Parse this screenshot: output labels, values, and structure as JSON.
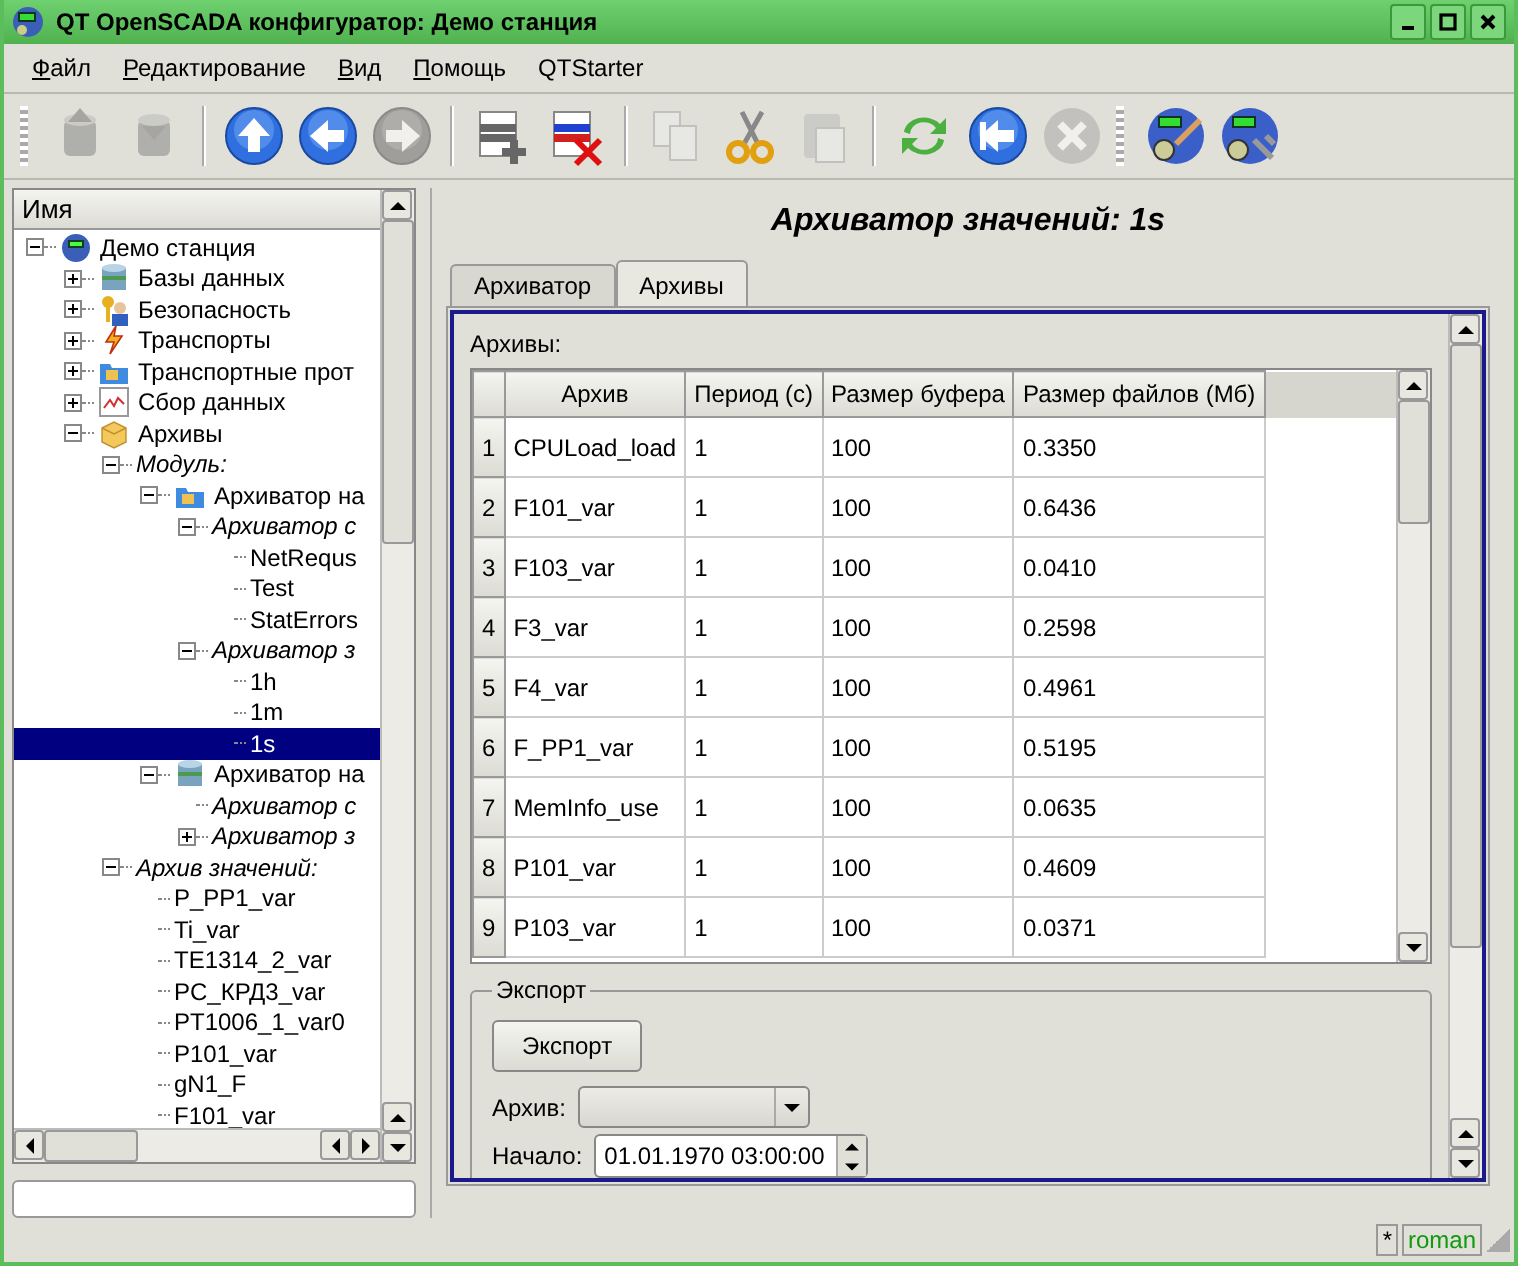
{
  "window": {
    "title": "QT OpenSCADA конфигуратор: Демо станция"
  },
  "menu": [
    {
      "label": "Файл",
      "underline_first": true
    },
    {
      "label": "Редактирование",
      "underline_first": true
    },
    {
      "label": "Вид",
      "underline_first": true
    },
    {
      "label": "Помощь",
      "underline_first": true
    },
    {
      "label": "QTStarter",
      "underline_first": false
    }
  ],
  "toolbar": [
    {
      "kind": "db-load",
      "disabled": true
    },
    {
      "kind": "db-save",
      "disabled": true
    },
    {
      "kind": "sep"
    },
    {
      "kind": "up",
      "disabled": false
    },
    {
      "kind": "back",
      "disabled": false
    },
    {
      "kind": "forward",
      "disabled": true
    },
    {
      "kind": "sep"
    },
    {
      "kind": "add",
      "disabled": false
    },
    {
      "kind": "delete",
      "disabled": false
    },
    {
      "kind": "sep"
    },
    {
      "kind": "copy",
      "disabled": true
    },
    {
      "kind": "cut",
      "disabled": false
    },
    {
      "kind": "paste",
      "disabled": true
    },
    {
      "kind": "sep"
    },
    {
      "kind": "refresh",
      "disabled": false
    },
    {
      "kind": "home",
      "disabled": false
    },
    {
      "kind": "stop",
      "disabled": true
    },
    {
      "kind": "grip"
    },
    {
      "kind": "station-edit",
      "disabled": false
    },
    {
      "kind": "station-tools",
      "disabled": false
    }
  ],
  "tree": {
    "header": "Имя",
    "items": [
      {
        "label": "Демо станция",
        "kind": "station",
        "expanded": true,
        "selected": false,
        "children": [
          {
            "label": "Базы данных",
            "kind": "db",
            "expanded": false,
            "selected": false
          },
          {
            "label": "Безопасность",
            "kind": "security",
            "expanded": false,
            "selected": false
          },
          {
            "label": "Транспорты",
            "kind": "transport",
            "expanded": false,
            "selected": false
          },
          {
            "label": "Транспортные прот",
            "kind": "protocol",
            "expanded": false,
            "selected": false
          },
          {
            "label": "Сбор данных",
            "kind": "daq",
            "expanded": false,
            "selected": false
          },
          {
            "label": "Архивы",
            "kind": "archive",
            "expanded": true,
            "selected": false,
            "children": [
              {
                "label": "Модуль:",
                "kind": "group",
                "expanded": true,
                "selected": false,
                "children": [
                  {
                    "label": "Архиватор на",
                    "kind": "archiver",
                    "expanded": true,
                    "selected": false,
                    "children": [
                      {
                        "label": "Архиватор с",
                        "kind": "group",
                        "expanded": true,
                        "selected": false,
                        "children": [
                          {
                            "label": "NetRequs",
                            "selected": false
                          },
                          {
                            "label": "Test",
                            "selected": false
                          },
                          {
                            "label": "StatErrors",
                            "selected": false
                          }
                        ]
                      },
                      {
                        "label": "Архиватор з",
                        "kind": "group",
                        "expanded": true,
                        "selected": false,
                        "children": [
                          {
                            "label": "1h",
                            "selected": false
                          },
                          {
                            "label": "1m",
                            "selected": false
                          },
                          {
                            "label": "1s",
                            "selected": true
                          }
                        ]
                      }
                    ]
                  },
                  {
                    "label": "Архиватор на",
                    "kind": "archiver-db",
                    "expanded": true,
                    "selected": false,
                    "children": [
                      {
                        "label": "Архиватор с",
                        "kind": "group",
                        "selected": false
                      },
                      {
                        "label": "Архиватор з",
                        "kind": "group",
                        "expanded": false,
                        "selected": false
                      }
                    ]
                  }
                ]
              },
              {
                "label": "Архив значений:",
                "kind": "group",
                "expanded": true,
                "selected": false,
                "children": [
                  {
                    "label": "P_PP1_var",
                    "selected": false
                  },
                  {
                    "label": "Ti_var",
                    "selected": false
                  },
                  {
                    "label": "TE1314_2_var",
                    "selected": false
                  },
                  {
                    "label": "PC_КРД3_var",
                    "selected": false
                  },
                  {
                    "label": "PT1006_1_var0",
                    "selected": false
                  },
                  {
                    "label": "P101_var",
                    "selected": false
                  },
                  {
                    "label": "gN1_F",
                    "selected": false
                  },
                  {
                    "label": "F101_var",
                    "selected": false
                  }
                ]
              }
            ]
          }
        ]
      }
    ]
  },
  "page": {
    "title": "Архиватор значений: 1s",
    "tabs": [
      {
        "label": "Архиватор",
        "selected": false
      },
      {
        "label": "Архивы",
        "selected": true
      }
    ],
    "table_label": "Архивы:",
    "table": {
      "columns": [
        "Архив",
        "Период (c)",
        "Размер буфера",
        "Размер файлов (Мб)"
      ],
      "rows": [
        {
          "n": "1",
          "cells": [
            "CPULoad_load",
            "1",
            "100",
            "0.3350"
          ]
        },
        {
          "n": "2",
          "cells": [
            "F101_var",
            "1",
            "100",
            "0.6436"
          ]
        },
        {
          "n": "3",
          "cells": [
            "F103_var",
            "1",
            "100",
            "0.0410"
          ]
        },
        {
          "n": "4",
          "cells": [
            "F3_var",
            "1",
            "100",
            "0.2598"
          ]
        },
        {
          "n": "5",
          "cells": [
            "F4_var",
            "1",
            "100",
            "0.4961"
          ]
        },
        {
          "n": "6",
          "cells": [
            "F_PP1_var",
            "1",
            "100",
            "0.5195"
          ]
        },
        {
          "n": "7",
          "cells": [
            "MemInfo_use",
            "1",
            "100",
            "0.0635"
          ]
        },
        {
          "n": "8",
          "cells": [
            "P101_var",
            "1",
            "100",
            "0.4609"
          ]
        },
        {
          "n": "9",
          "cells": [
            "P103_var",
            "1",
            "100",
            "0.0371"
          ]
        }
      ]
    },
    "export": {
      "legend": "Экспорт",
      "button": "Экспорт",
      "archive_label": "Архив:",
      "start_label": "Начало:",
      "start_value": "01.01.1970 03:00:00"
    }
  },
  "status_bar": {
    "modified": "*",
    "user": "roman"
  }
}
